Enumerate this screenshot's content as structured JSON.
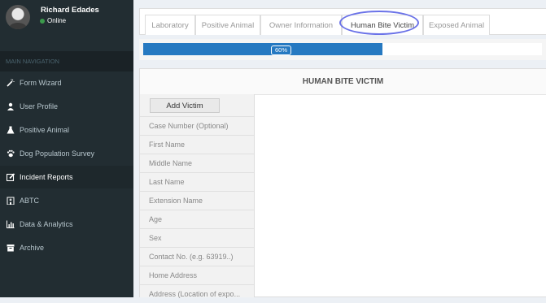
{
  "user": {
    "name": "Richard Edades",
    "status": "Online"
  },
  "nav": {
    "header": "MAIN NAVIGATION",
    "items": [
      {
        "label": "Form Wizard",
        "icon": "wand-icon"
      },
      {
        "label": "User Profile",
        "icon": "user-profile-icon"
      },
      {
        "label": "Positive Animal",
        "icon": "flask-icon"
      },
      {
        "label": "Dog Population Survey",
        "icon": "paw-icon"
      },
      {
        "label": "Incident Reports",
        "icon": "edit-icon"
      },
      {
        "label": "ABTC",
        "icon": "hospital-icon"
      },
      {
        "label": "Data & Analytics",
        "icon": "bar-chart-icon"
      },
      {
        "label": "Archive",
        "icon": "archive-icon"
      }
    ],
    "active_index": 4
  },
  "tabs": [
    "Laboratory",
    "Positive Animal",
    "Owner Information",
    "Human Bite Victim",
    "Exposed Animal"
  ],
  "active_tab": "Human Bite Victim",
  "progress": {
    "value": 60,
    "label": "60%"
  },
  "section": {
    "title": "HUMAN BITE VICTIM",
    "add_button": "Add Victim",
    "fields": [
      "Case Number (Optional)",
      "First Name",
      "Middle Name",
      "Last Name",
      "Extension Name",
      "Age",
      "Sex",
      "Contact No. (e.g. 63919..)",
      "Home Address",
      "Address (Location of expo..."
    ]
  },
  "colors": {
    "sidebar": "#222d32",
    "progress": "#2679c1",
    "highlight": "#6a72e8"
  }
}
